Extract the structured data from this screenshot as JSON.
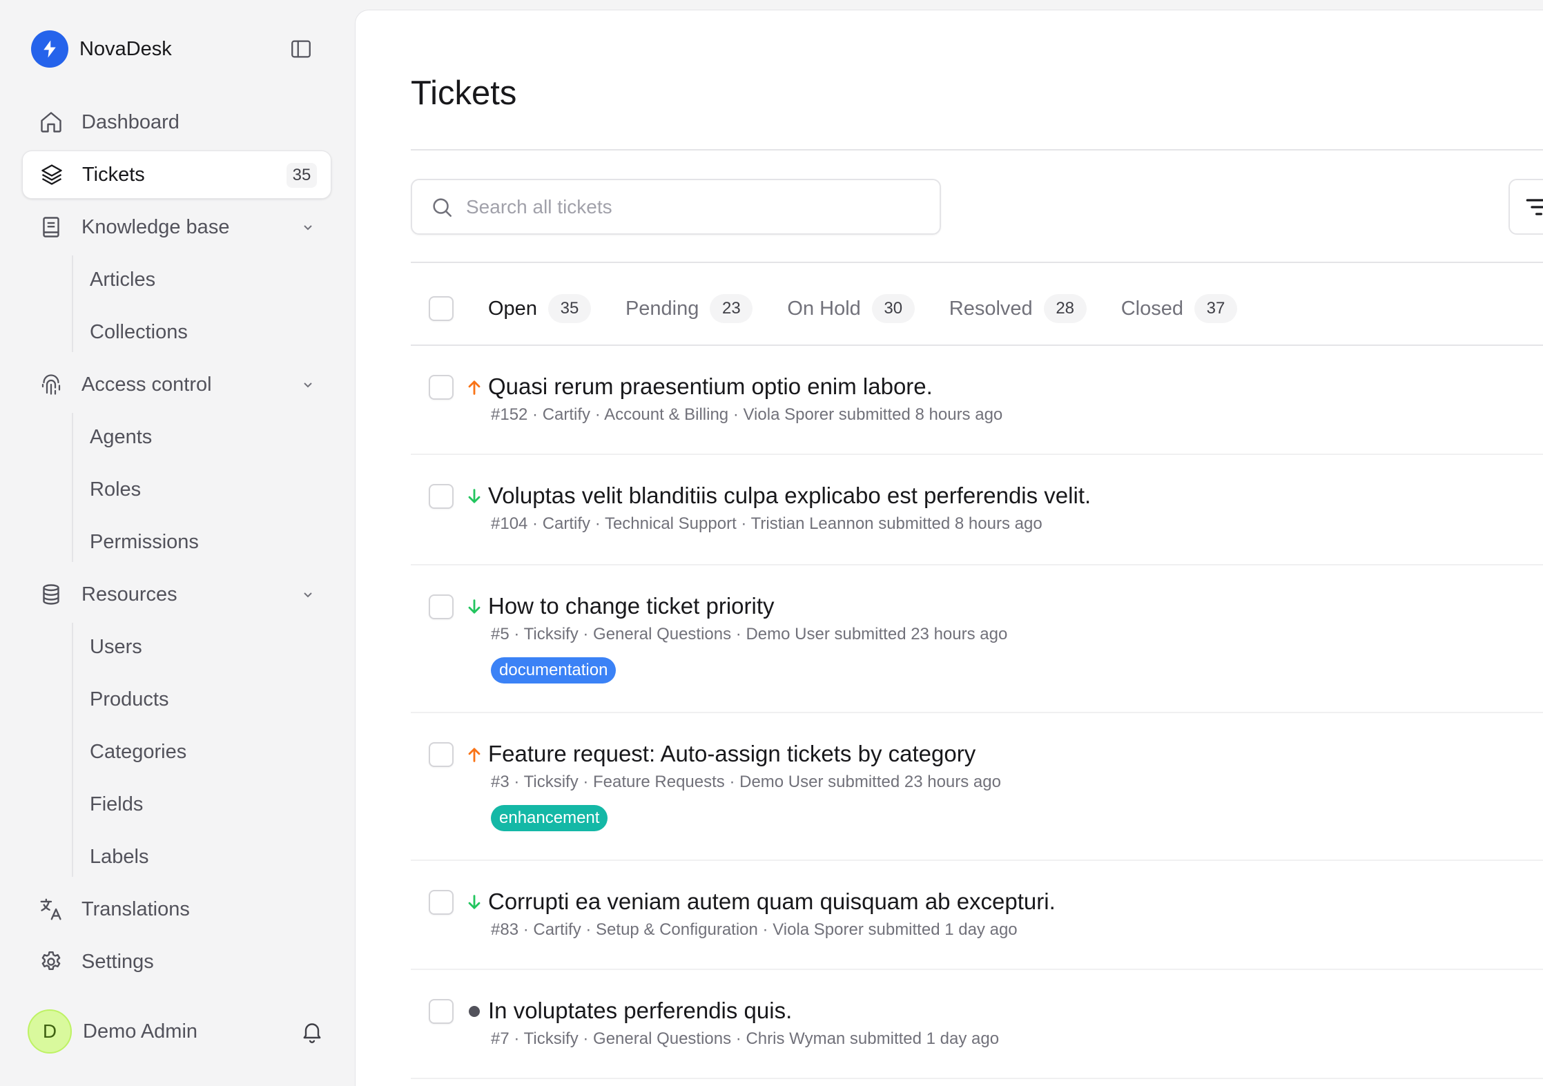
{
  "app": {
    "name": "NovaDesk"
  },
  "sidebar": {
    "items": [
      {
        "label": "Dashboard"
      },
      {
        "label": "Tickets",
        "badge": "35"
      },
      {
        "label": "Knowledge base",
        "children": [
          "Articles",
          "Collections"
        ]
      },
      {
        "label": "Access control",
        "children": [
          "Agents",
          "Roles",
          "Permissions"
        ]
      },
      {
        "label": "Resources",
        "children": [
          "Users",
          "Products",
          "Categories",
          "Fields",
          "Labels"
        ]
      },
      {
        "label": "Translations"
      },
      {
        "label": "Settings"
      }
    ],
    "user": {
      "initial": "D",
      "name": "Demo Admin"
    }
  },
  "page": {
    "title": "Tickets"
  },
  "search": {
    "placeholder": "Search all tickets",
    "value": ""
  },
  "tabs": [
    {
      "label": "Open",
      "count": "35",
      "active": true
    },
    {
      "label": "Pending",
      "count": "23"
    },
    {
      "label": "On Hold",
      "count": "30"
    },
    {
      "label": "Resolved",
      "count": "28"
    },
    {
      "label": "Closed",
      "count": "37"
    }
  ],
  "tickets": [
    {
      "title": "Quasi rerum praesentium optio enim labore.",
      "meta": "#152 · Cartify · Account & Billing · Viola Sporer submitted 8 hours ago",
      "priority": "high",
      "tag": null
    },
    {
      "title": "Voluptas velit blanditiis culpa explicabo est perferendis velit.",
      "meta": "#104 · Cartify · Technical Support · Tristian Leannon submitted 8 hours ago",
      "priority": "low",
      "tag": null
    },
    {
      "title": "How to change ticket priority",
      "meta": "#5 · Ticksify · General Questions · Demo User submitted 23 hours ago",
      "priority": "low",
      "tag": "documentation"
    },
    {
      "title": "Feature request: Auto-assign tickets by category",
      "meta": "#3 · Ticksify · Feature Requests · Demo User submitted 23 hours ago",
      "priority": "high",
      "tag": "enhancement"
    },
    {
      "title": "Corrupti ea veniam autem quam quisquam ab excepturi.",
      "meta": "#83 · Cartify · Setup & Configuration · Viola Sporer submitted 1 day ago",
      "priority": "low",
      "tag": null
    },
    {
      "title": "In voluptates perferendis quis.",
      "meta": "#7 · Ticksify · General Questions · Chris Wyman submitted 1 day ago",
      "priority": "normal",
      "tag": null
    }
  ],
  "colors": {
    "brand": "#2563eb",
    "priority_high": "#f97316",
    "priority_low": "#22c55e",
    "priority_normal": "#52525b",
    "tag_documentation": "#3b82f6",
    "tag_enhancement": "#14b8a6"
  }
}
